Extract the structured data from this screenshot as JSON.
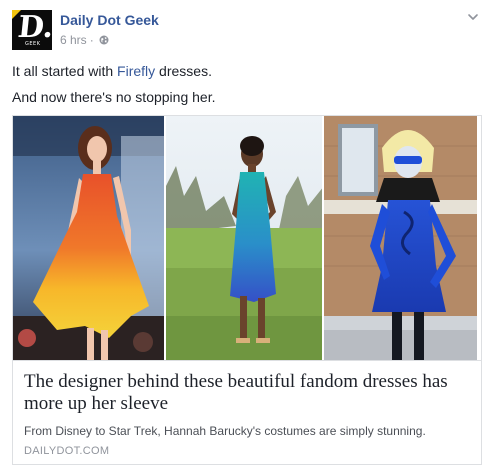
{
  "post": {
    "page_name": "Daily Dot Geek",
    "avatar_glyph": "D.",
    "avatar_tag": "GEEK",
    "timestamp": "6 hrs",
    "separator": "·",
    "privacy_icon": "globe-icon",
    "menu_icon": "chevron-down-icon",
    "message_line1_before": "It all started with ",
    "message_link": "Firefly",
    "message_line1_after": " dresses.",
    "message_line2": "And now there's no stopping her."
  },
  "attachment": {
    "photos": [
      {
        "name": "photo-orange-dress"
      },
      {
        "name": "photo-teal-dress"
      },
      {
        "name": "photo-blue-costume"
      }
    ],
    "headline": "The designer behind these beautiful fandom dresses has more up her sleeve",
    "description": "From Disney to Star Trek, Hannah Barucky's costumes are simply stunning.",
    "domain": "DAILYDOT.COM"
  },
  "colors": {
    "link": "#365899",
    "text": "#1d2129",
    "meta": "#90949c",
    "border": "#dddfe2",
    "avatar_bg": "#0b0b0b",
    "avatar_accent": "#f2c40f"
  }
}
